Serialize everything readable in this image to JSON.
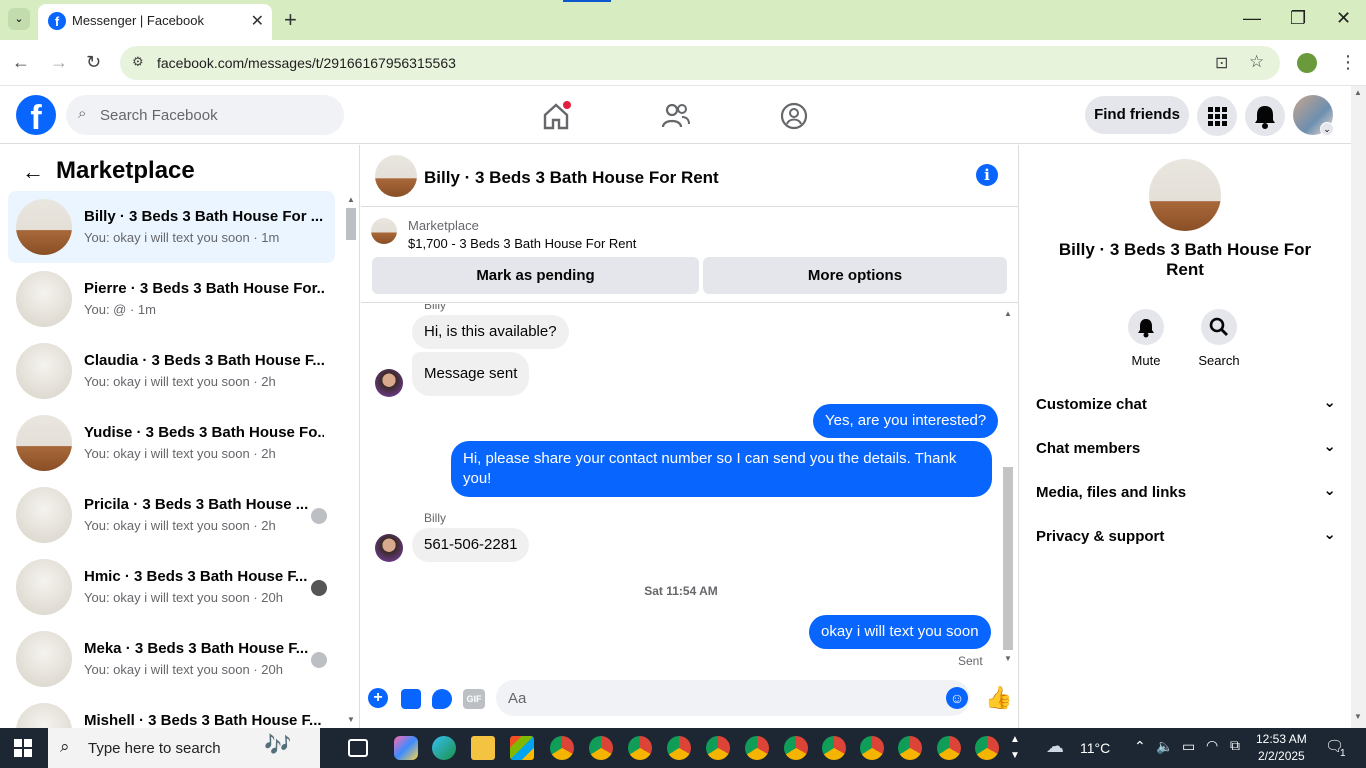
{
  "browser": {
    "tab_title": "Messenger | Facebook",
    "url": "facebook.com/messages/t/29166167956315563"
  },
  "fb_header": {
    "search_placeholder": "Search Facebook",
    "find_friends": "Find friends"
  },
  "left_panel": {
    "title": "Marketplace",
    "conversations": [
      {
        "name": "Billy · 3 Beds 3 Bath House For ...",
        "snippet": "You: okay i will text you soon · 1m"
      },
      {
        "name": "Pierre · 3 Beds 3 Bath House For...",
        "snippet": "You: @ · 1m"
      },
      {
        "name": "Claudia · 3 Beds 3 Bath House F...",
        "snippet": "You: okay i will text you soon · 2h"
      },
      {
        "name": "Yudise · 3 Beds 3 Bath House Fo...",
        "snippet": "You: okay i will text you soon · 2h"
      },
      {
        "name": "Pricila · 3 Beds 3 Bath House ...",
        "snippet": "You: okay i will text you soon · 2h"
      },
      {
        "name": "Hmic · 3 Beds 3 Bath House F...",
        "snippet": "You: okay i will text you soon · 20h"
      },
      {
        "name": "Meka · 3 Beds 3 Bath House F...",
        "snippet": "You: okay i will text you soon · 20h"
      },
      {
        "name": "Mishell · 3 Beds 3 Bath House F...",
        "snippet": ""
      }
    ]
  },
  "chat": {
    "title": "Billy · 3 Beds 3 Bath House For Rent",
    "marketplace_label": "Marketplace",
    "listing": "$1,700 - 3 Beds 3 Bath House For Rent",
    "mark_pending": "Mark as pending",
    "more_options": "More options",
    "messages": {
      "sender_top": "Billy",
      "m1": "Hi, is this available?",
      "m2": "Message sent",
      "m3": "Yes, are you interested?",
      "m4": "Hi, please share your contact number so I can send you the details. Thank you!",
      "sender2": "Billy",
      "m5": "561-506-2281",
      "timestamp": "Sat 11:54 AM",
      "m6": "okay i will text you soon",
      "status": "Sent"
    },
    "composer_placeholder": "Aa"
  },
  "right_panel": {
    "name": "Billy · 3 Beds 3 Bath House For Rent",
    "mute": "Mute",
    "search": "Search",
    "sections": [
      "Customize chat",
      "Chat members",
      "Media, files and links",
      "Privacy & support"
    ]
  },
  "taskbar": {
    "search_placeholder": "Type here to search",
    "weather": "11°C",
    "time": "12:53 AM",
    "date": "2/2/2025",
    "notifications": "1"
  }
}
